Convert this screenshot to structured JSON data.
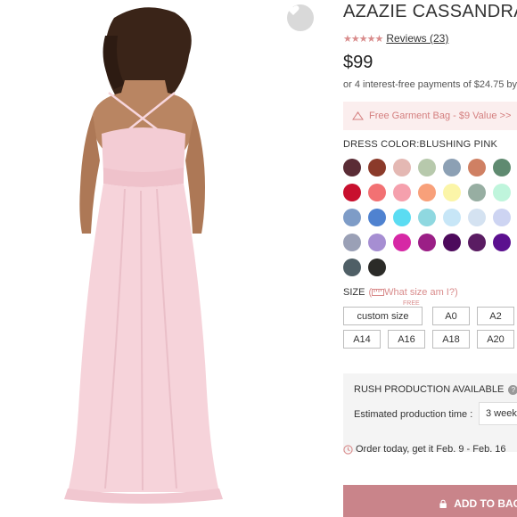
{
  "product": {
    "title": "AZAZIE CASSANDRA",
    "rating_stars": "★★★★★",
    "rating_value": 4.5,
    "reviews_label": "Reviews (23)",
    "price": "$99",
    "installments": "or 4 interest-free payments of $24.75 by"
  },
  "promo": {
    "text": "Free Garment Bag - $9 Value >>"
  },
  "color": {
    "label": "DRESS COLOR:BLUSHING PINK",
    "swatches": [
      "#5a2c35",
      "#8b3a2a",
      "#e4b8b3",
      "#b7c9ac",
      "#8ca0b4",
      "#cf8063",
      "#5f8a70",
      "#c8102e",
      "#f27173",
      "#f5a0ad",
      "#f8a07a",
      "#fbf5a8",
      "#97aea2",
      "#bff5dc",
      "#7e9cc7",
      "#4f82d0",
      "#5bdcf2",
      "#8fd8e0",
      "#c7e6f7",
      "#d4e2f1",
      "#cdd4f2",
      "#9aa0b6",
      "#a68ed2",
      "#d628a5",
      "#9b1f86",
      "#4d0a5c",
      "#5a1c62",
      "#5b108f",
      "#4f5f66",
      "#2b2b28"
    ]
  },
  "size": {
    "label": "SIZE",
    "help": "What size am I?",
    "free_tag": "FREE",
    "options": [
      "custom size",
      "A0",
      "A2",
      "A14",
      "A16",
      "A18",
      "A20"
    ]
  },
  "rush": {
    "title": "RUSH PRODUCTION AVAILABLE",
    "help_icon": "?",
    "est_label": "Estimated production time :",
    "est_value": "3 week"
  },
  "order": {
    "text": "Order today, get it Feb. 9 - Feb. 16"
  },
  "cart": {
    "button": "ADD TO BAG"
  }
}
